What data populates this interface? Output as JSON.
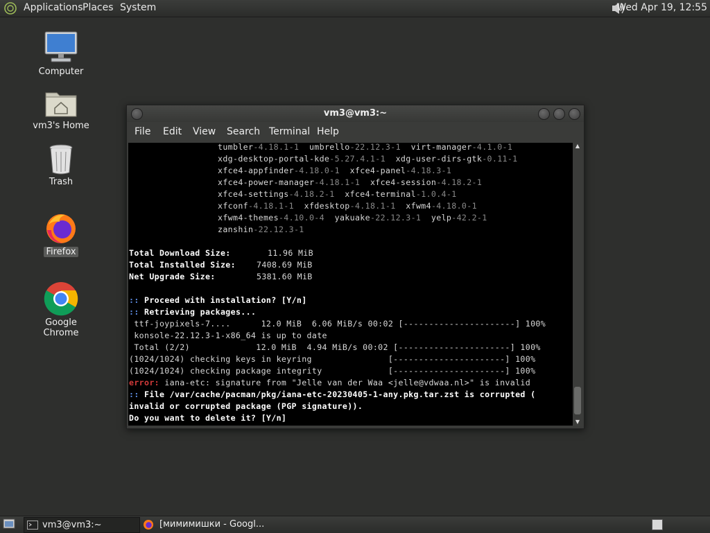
{
  "top_panel": {
    "menus": [
      "Applications",
      "Places",
      "System"
    ],
    "clock": "Wed Apr 19, 12:55"
  },
  "desktop": {
    "icons": [
      {
        "label": "Computer"
      },
      {
        "label": "vm3's Home"
      },
      {
        "label": "Trash"
      },
      {
        "label": "Firefox"
      },
      {
        "label": "Google Chrome"
      }
    ]
  },
  "window": {
    "title": "vm3@vm3:~",
    "menu": [
      "File",
      "Edit",
      "View",
      "Search",
      "Terminal",
      "Help"
    ]
  },
  "terminal": {
    "packages": [
      [
        [
          "tumbler",
          "-4.18.1-1"
        ],
        [
          "umbrello",
          "-22.12.3-1"
        ],
        [
          "virt-manager",
          "-4.1.0-1"
        ]
      ],
      [
        [
          "xdg-desktop-portal-kde",
          "-5.27.4.1-1"
        ],
        [
          "xdg-user-dirs-gtk",
          "-0.11-1"
        ]
      ],
      [
        [
          "xfce4-appfinder",
          "-4.18.0-1"
        ],
        [
          "xfce4-panel",
          "-4.18.3-1"
        ]
      ],
      [
        [
          "xfce4-power-manager",
          "-4.18.1-1"
        ],
        [
          "xfce4-session",
          "-4.18.2-1"
        ]
      ],
      [
        [
          "xfce4-settings",
          "-4.18.2-1"
        ],
        [
          "xfce4-terminal",
          "-1.0.4-1"
        ]
      ],
      [
        [
          "xfconf",
          "-4.18.1-1"
        ],
        [
          "xfdesktop",
          "-4.18.1-1"
        ],
        [
          "xfwm4",
          "-4.18.0-1"
        ]
      ],
      [
        [
          "xfwm4-themes",
          "-4.10.0-4"
        ],
        [
          "yakuake",
          "-22.12.3-1"
        ],
        [
          "yelp",
          "-42.2-1"
        ]
      ],
      [
        [
          "zanshin",
          "-22.12.3-1"
        ]
      ]
    ],
    "sizes": [
      {
        "label": "Total Download Size:",
        "value": "11.96 MiB"
      },
      {
        "label": "Total Installed Size:",
        "value": "7408.69 MiB"
      },
      {
        "label": "Net Upgrade Size:",
        "value": "5381.60 MiB"
      }
    ],
    "prompt_marker": "::",
    "proceed": "Proceed with installation? [Y/n]",
    "retrieving": "Retrieving packages...",
    "progress_lines": [
      " ttf-joypixels-7....      12.0 MiB  6.06 MiB/s 00:02 [----------------------] 100%",
      " konsole-22.12.3-1-x86_64 is up to date",
      " Total (2/2)             12.0 MiB  4.94 MiB/s 00:02 [----------------------] 100%",
      "(1024/1024) checking keys in keyring               [----------------------] 100%",
      "(1024/1024) checking package integrity             [----------------------] 100%"
    ],
    "error_label": "error:",
    "error_text": " iana-etc: signature from \"Jelle van der Waa <jelle@vdwaa.nl>\" is invalid",
    "corrupt_line1": " File /var/cache/pacman/pkg/iana-etc-20230405-1-any.pkg.tar.zst is corrupted (",
    "corrupt_line2": "invalid or corrupted package (PGP signature)).",
    "delete_prompt": "Do you want to delete it? [Y/n]"
  },
  "taskbar": {
    "tasks": [
      {
        "label": "vm3@vm3:~"
      },
      {
        "label": "[мимимишки - Googl..."
      }
    ]
  }
}
